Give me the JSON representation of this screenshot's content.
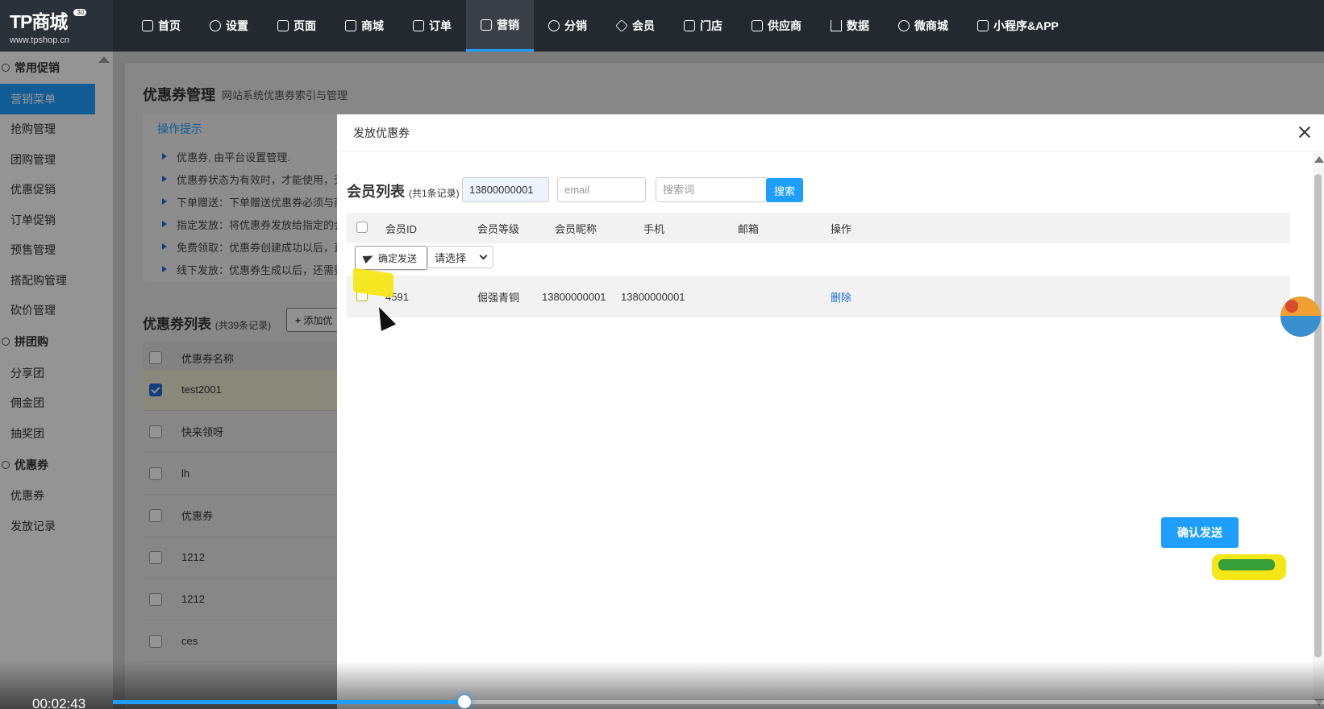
{
  "logo": {
    "brand": "TP商城",
    "version": "3.0",
    "url": "www.tpshop.cn"
  },
  "nav": [
    {
      "label": "首页",
      "icon": "dashboard-icon"
    },
    {
      "label": "设置",
      "icon": "gear-icon"
    },
    {
      "label": "页面",
      "icon": "page-icon"
    },
    {
      "label": "商城",
      "icon": "bag-icon"
    },
    {
      "label": "订单",
      "icon": "order-icon"
    },
    {
      "label": "营销",
      "icon": "chart-icon",
      "active": true
    },
    {
      "label": "分销",
      "icon": "users-icon"
    },
    {
      "label": "会员",
      "icon": "diamond-icon"
    },
    {
      "label": "门店",
      "icon": "store-icon"
    },
    {
      "label": "供应商",
      "icon": "supplier-icon"
    },
    {
      "label": "数据",
      "icon": "bar-icon"
    },
    {
      "label": "微商城",
      "icon": "wechat-icon"
    },
    {
      "label": "小程序&APP",
      "icon": "cube-icon"
    }
  ],
  "sidebar": {
    "groups": [
      {
        "title": "常用促销",
        "items": [
          "营销菜单",
          "抢购管理",
          "团购管理",
          "优惠促销",
          "订单促销",
          "预售管理",
          "搭配购管理",
          "砍价管理"
        ]
      },
      {
        "title": "拼团购",
        "items": [
          "分享团",
          "佣金团",
          "抽奖团"
        ]
      },
      {
        "title": "优惠券",
        "items": [
          "优惠券",
          "发放记录"
        ]
      }
    ],
    "active_item": "营销菜单"
  },
  "page": {
    "title": "优惠券管理",
    "subtitle": "网站系统优惠券索引与管理",
    "tips_title": "操作提示",
    "tips": [
      "优惠券, 由平台设置管理.",
      "优惠券状态为有效时，才能使用，无",
      "下单赠送：下单赠送优惠券必须与商",
      "指定发放：将优惠券发放给指定的会",
      "免费领取：优惠券创建成功以后，直",
      "线下发放：优惠券生成以后，还需要"
    ],
    "list_title": "优惠券列表",
    "list_count": "(共39条记录)",
    "add_button": "添加优",
    "column_name": "优惠券名称",
    "coupons": [
      "test2001",
      "快来领呀",
      "lh",
      "优惠券",
      "1212",
      "1212",
      "ces"
    ]
  },
  "modal": {
    "title": "发放优惠券",
    "list_title": "会员列表",
    "list_count": "(共1条记录)",
    "phone_value": "13800000001",
    "email_placeholder": "email",
    "keyword_placeholder": "搜索词",
    "search_button": "搜索",
    "columns": [
      "会员ID",
      "会员等级",
      "会员昵称",
      "手机",
      "邮箱",
      "操作"
    ],
    "send_button": "确定发送",
    "select_value": "请选择",
    "rows": [
      {
        "id": "4591",
        "level": "倔强青铜",
        "nickname": "13800000001",
        "phone": "13800000001",
        "email": "",
        "action": "删除"
      }
    ],
    "confirm_button": "确认发送"
  },
  "video": {
    "time": "00:02:43",
    "progress": 0.29
  }
}
